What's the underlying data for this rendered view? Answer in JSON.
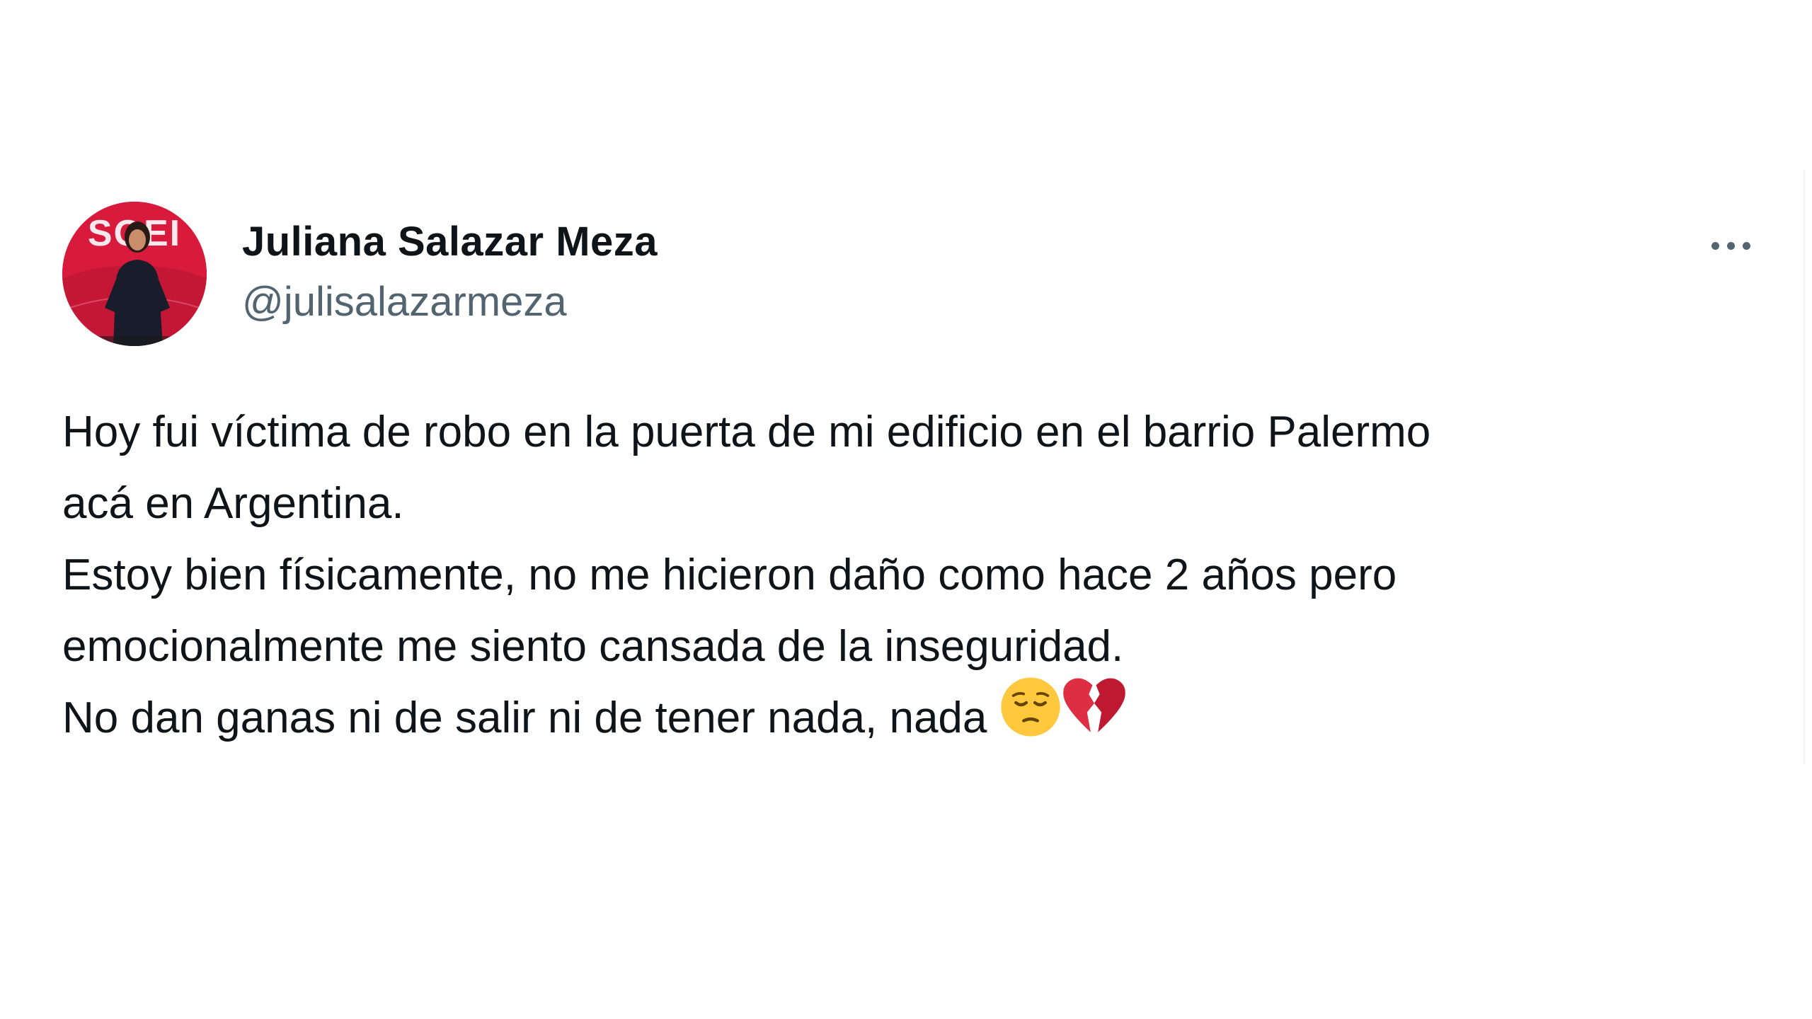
{
  "tweet": {
    "author": {
      "name": "Juliana Salazar Meza",
      "handle": "@julisalazarmeza",
      "avatar_backdrop_text": "SOEI"
    },
    "more_button_label": "More",
    "text_lines": [
      "Hoy fui víctima de robo en la puerta de mi edificio en el barrio Palermo",
      "acá en Argentina.",
      "Estoy bien físicamente, no me hicieron daño como hace 2 años pero",
      "emocionalmente me siento cansada de la inseguridad.",
      "No dan ganas ni de salir ni de tener nada, nada"
    ],
    "emojis": [
      "pensive-face-emoji",
      "broken-heart-emoji"
    ]
  },
  "colors": {
    "text_primary": "#0f1419",
    "text_secondary": "#536471",
    "avatar_background": "#d81b3c",
    "emoji_face": "#ffc83d",
    "emoji_heart": "#dd2e44"
  }
}
